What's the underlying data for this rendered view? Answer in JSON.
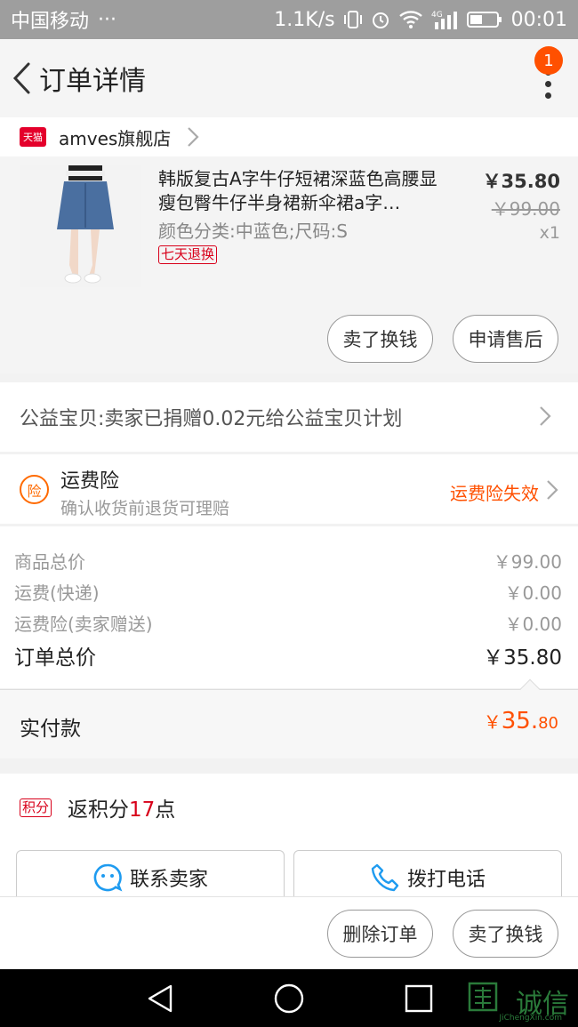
{
  "status_bar": {
    "carrier": "中国移动",
    "dots": "···",
    "speed": "1.1K/s",
    "network": "4G",
    "time": "00:01"
  },
  "header": {
    "back_icon": "chevron-left-icon",
    "title": "订单详情",
    "badge": "1",
    "more_icon": "more-vertical-icon"
  },
  "store": {
    "logo_text": "天猫",
    "name": "amves旗舰店"
  },
  "product": {
    "title": "韩版复古A字牛仔短裙深蓝色高腰显瘦包臀牛仔半身裙新伞裙a字…",
    "sku": "颜色分类:中蓝色;尺码:S",
    "tag": "七天退换",
    "price": "￥35.80",
    "original_price": "￥99.00",
    "quantity": "x1",
    "buttons": {
      "sell": "卖了换钱",
      "after_sale": "申请售后"
    }
  },
  "charity": {
    "text": "公益宝贝:卖家已捐赠0.02元给公益宝贝计划"
  },
  "insurance": {
    "icon_text": "险",
    "title": "运费险",
    "subtitle": "确认收货前退货可理赔",
    "status": "运费险失效"
  },
  "summary": {
    "rows": [
      {
        "label": "商品总价",
        "value": "￥99.00"
      },
      {
        "label": "运费(快递)",
        "value": "￥0.00"
      },
      {
        "label": "运费险(卖家赠送)",
        "value": "￥0.00"
      }
    ],
    "total_label": "订单总价",
    "total_value": "￥35.80"
  },
  "payment": {
    "label": "实付款",
    "symbol": "￥",
    "integer": "35.",
    "decimal": "80"
  },
  "points": {
    "badge": "积分",
    "text_prefix": "返积分",
    "number": "17",
    "text_suffix": "点"
  },
  "contact": {
    "seller": "联系卖家",
    "phone": "拨打电话"
  },
  "bottom_actions": {
    "delete": "删除订单",
    "sell": "卖了换钱"
  },
  "watermark": {
    "text": "诚信",
    "sub": "JiChengXin.com"
  },
  "colors": {
    "accent": "#ff5000",
    "tmall": "#e4002b",
    "tag_red": "#d8001a"
  }
}
